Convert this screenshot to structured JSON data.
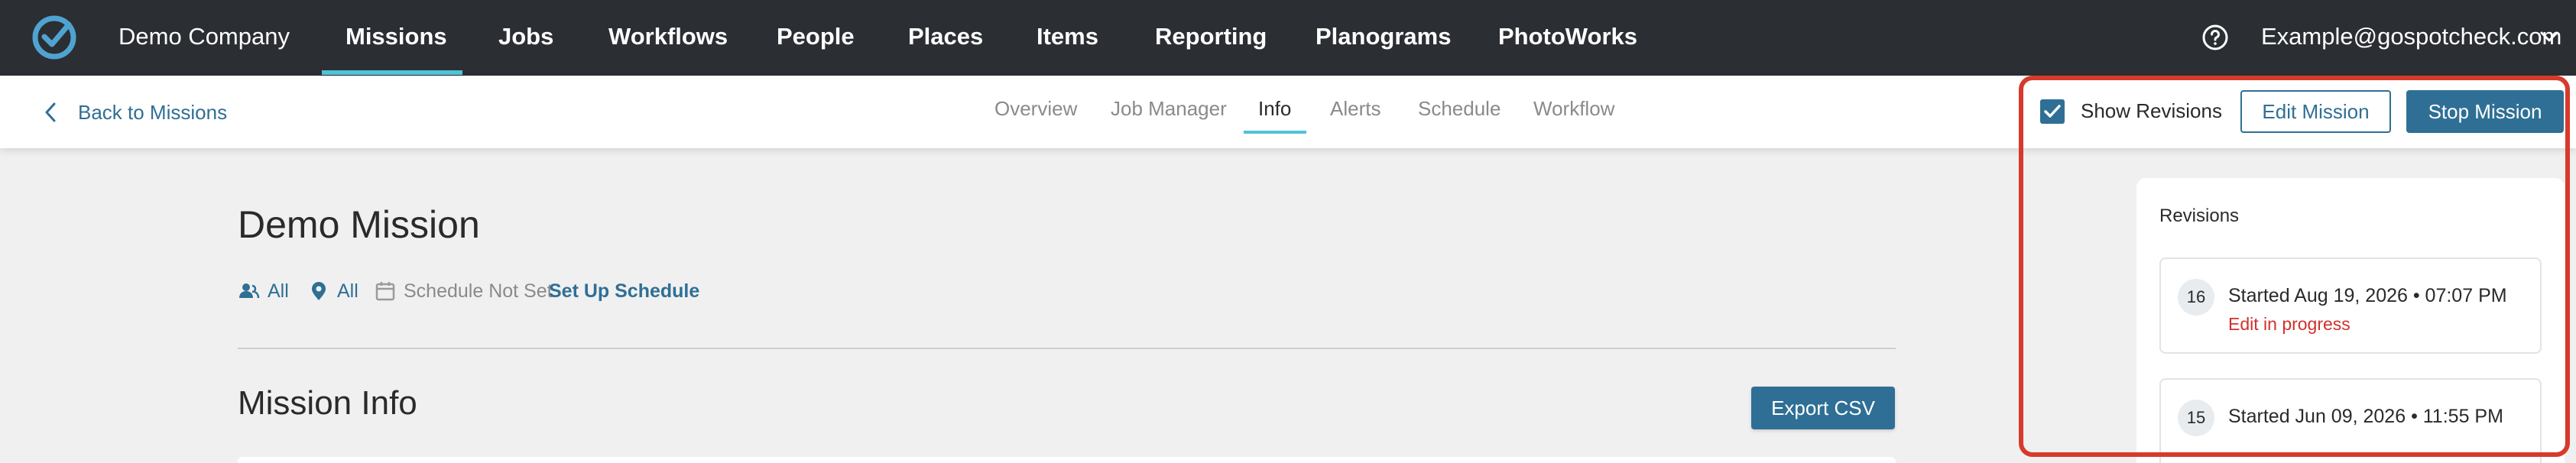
{
  "header": {
    "company": "Demo Company",
    "nav": [
      {
        "label": "Missions"
      },
      {
        "label": "Jobs"
      },
      {
        "label": "Workflows"
      },
      {
        "label": "People"
      },
      {
        "label": "Places"
      },
      {
        "label": "Items"
      },
      {
        "label": "Reporting"
      },
      {
        "label": "Planograms"
      },
      {
        "label": "PhotoWorks"
      }
    ],
    "active_nav": "Missions",
    "user_email": "Example@gospotcheck.com"
  },
  "subheader": {
    "back_label": "Back to Missions",
    "tabs": [
      {
        "label": "Overview"
      },
      {
        "label": "Job Manager"
      },
      {
        "label": "Info"
      },
      {
        "label": "Alerts"
      },
      {
        "label": "Schedule"
      },
      {
        "label": "Workflow"
      }
    ],
    "active_tab": "Info",
    "show_revisions_label": "Show Revisions",
    "show_revisions_checked": true,
    "edit_label": "Edit Mission",
    "stop_label": "Stop Mission"
  },
  "mission": {
    "title": "Demo Mission",
    "people": "All",
    "places": "All",
    "schedule_status": "Schedule Not Set",
    "setup_schedule": "Set Up Schedule",
    "section_title": "Mission Info",
    "export_label": "Export CSV"
  },
  "revisions": {
    "title": "Revisions",
    "items": [
      {
        "number": "16",
        "started": "Started Aug 19, 2026 • 07:07 PM",
        "status": "Edit in progress"
      },
      {
        "number": "15",
        "started": "Started Jun 09, 2026 • 11:55 PM",
        "status": ""
      }
    ]
  },
  "colors": {
    "nav_bg": "#2b2e33",
    "accent": "#4fc3d8",
    "primary": "#2f6f95",
    "highlight": "#d63a2b",
    "status_red": "#d0312d"
  }
}
